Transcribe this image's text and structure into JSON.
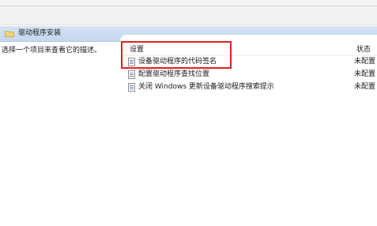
{
  "header": {
    "title": "驱动程序安装",
    "folder_icon": "folder-icon"
  },
  "left_panel": {
    "description": "选择一个项目来查看它的描述。"
  },
  "list": {
    "columns": {
      "setting": "设置",
      "status": "状态"
    },
    "rows": [
      {
        "label": "设备驱动程序的代码签名",
        "status": "未配置",
        "icon": "policy-setting-icon"
      },
      {
        "label": "配置驱动程序查找位置",
        "status": "未配置",
        "icon": "policy-setting-icon"
      },
      {
        "label": "关闭 Windows 更新设备驱动程序搜索提示",
        "status": "未配置",
        "icon": "policy-setting-icon"
      }
    ]
  },
  "colors": {
    "header_bar": "#c8daf0",
    "highlight_border": "#e02020"
  }
}
